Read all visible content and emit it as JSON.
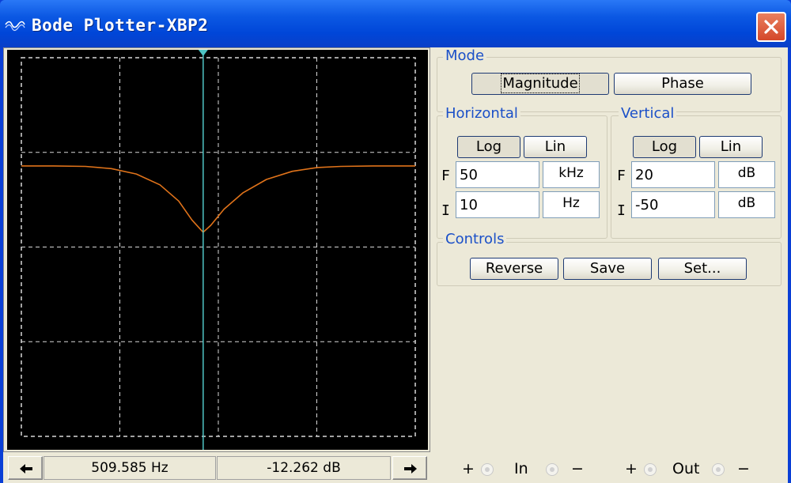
{
  "window": {
    "title": "Bode Plotter-XBP2"
  },
  "mode": {
    "label": "Mode",
    "magnitude_label": "Magnitude",
    "phase_label": "Phase",
    "selected": "Magnitude"
  },
  "horizontal": {
    "label": "Horizontal",
    "log_label": "Log",
    "lin_label": "Lin",
    "selected_scale": "Log",
    "final_label": "F",
    "final_value": "50",
    "final_unit": "kHz",
    "initial_label": "I",
    "initial_value": "10",
    "initial_unit": "Hz"
  },
  "vertical": {
    "label": "Vertical",
    "log_label": "Log",
    "lin_label": "Lin",
    "selected_scale": "Log",
    "final_label": "F",
    "final_value": "20",
    "final_unit": "dB",
    "initial_label": "I",
    "initial_value": "-50",
    "initial_unit": "dB"
  },
  "controls": {
    "label": "Controls",
    "reverse_label": "Reverse",
    "save_label": "Save",
    "set_label": "Set..."
  },
  "readout": {
    "frequency": "509.585 Hz",
    "magnitude": "-12.262 dB"
  },
  "pins": {
    "in_label": "In",
    "out_label": "Out",
    "plus": "+",
    "minus": "−"
  },
  "colors": {
    "trace": "#e0731a",
    "cursor": "#4fc4c4",
    "grid": "#d8d8d8",
    "screen": "#000000",
    "group_label": "#1b50c8"
  },
  "chart_data": {
    "type": "line",
    "x_scale": "log",
    "x_range_hz": [
      10,
      50000
    ],
    "y_range_db": [
      -50,
      20
    ],
    "grid": true,
    "series": [
      {
        "x": [
          10,
          20,
          40,
          70,
          120,
          200,
          300,
          400,
          509.585,
          600,
          800,
          1200,
          2000,
          3500,
          6000,
          10000,
          20000,
          50000
        ],
        "values": [
          0,
          0,
          -0.1,
          -0.5,
          -1.5,
          -3.5,
          -6.5,
          -10,
          -12.262,
          -11,
          -8,
          -5,
          -2.5,
          -1,
          -0.3,
          -0.1,
          0,
          0
        ]
      }
    ],
    "cursor": {
      "x": 509.585,
      "y": -12.262
    }
  }
}
